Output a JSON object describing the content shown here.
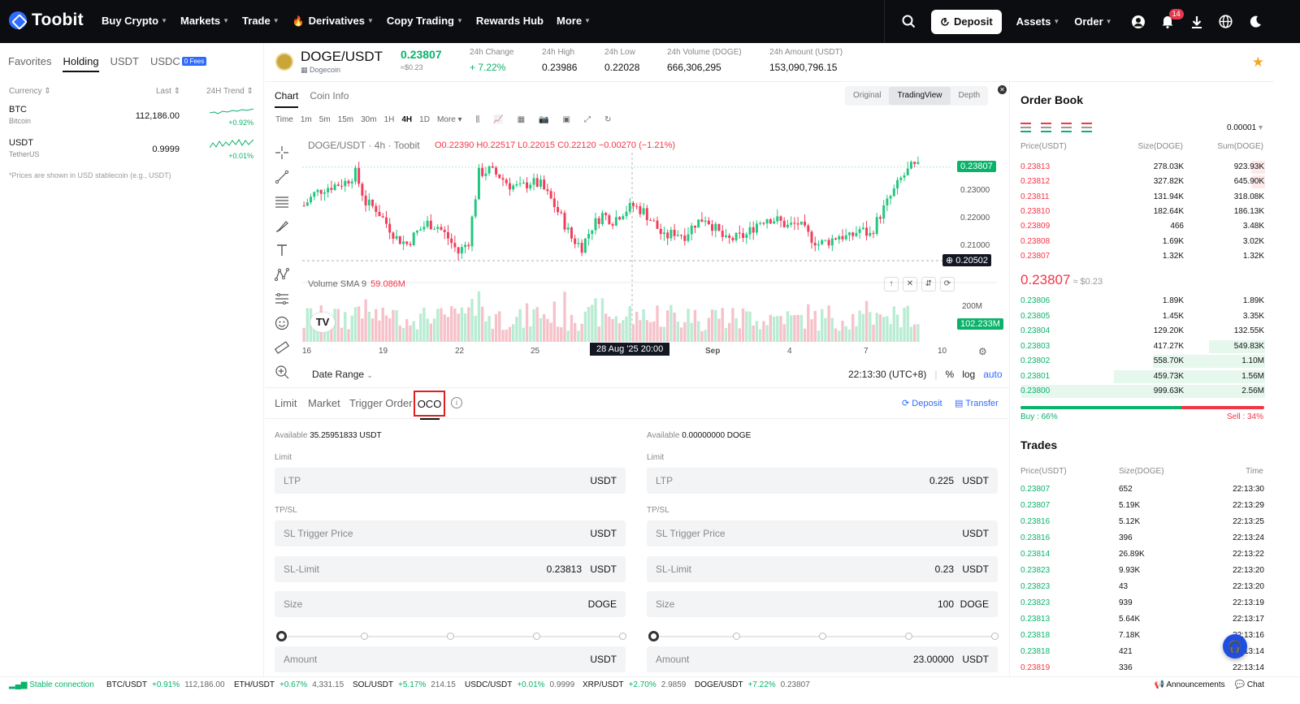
{
  "nav": {
    "brand": "Toobit",
    "items": [
      {
        "label": "Buy Crypto",
        "caret": true
      },
      {
        "label": "Markets",
        "caret": true
      },
      {
        "label": "Trade",
        "caret": true
      },
      {
        "label": "Derivatives",
        "caret": true
      },
      {
        "label": "Copy Trading",
        "caret": true
      },
      {
        "label": "Rewards Hub",
        "caret": false
      },
      {
        "label": "More",
        "caret": true
      }
    ],
    "deposit": "Deposit",
    "assets": "Assets",
    "order": "Order",
    "notif_count": "14"
  },
  "left": {
    "tabs": [
      "Favorites",
      "Holding",
      "USDT",
      "USDC"
    ],
    "fees_badge": "0 Fees",
    "headers": {
      "currency": "Currency",
      "last": "Last",
      "trend": "24H Trend"
    },
    "rows": [
      {
        "symbol": "BTC",
        "name": "Bitcoin",
        "last": "112,186.00",
        "change": "+0.92%"
      },
      {
        "symbol": "USDT",
        "name": "TetherUS",
        "last": "0.9999",
        "change": "+0.01%"
      }
    ],
    "note": "*Prices are shown in USD stablecoin (e.g., USDT)"
  },
  "ticker": {
    "pair": "DOGE/USDT",
    "name": "Dogecoin",
    "last": "0.23807",
    "last_usd": "≈$0.23",
    "stats": [
      {
        "label": "24h Change",
        "value": "+ 7.22%"
      },
      {
        "label": "24h High",
        "value": "0.23986"
      },
      {
        "label": "24h Low",
        "value": "0.22028"
      },
      {
        "label": "24h Volume (DOGE)",
        "value": "666,306,295"
      },
      {
        "label": "24h Amount (USDT)",
        "value": "153,090,796.15"
      }
    ]
  },
  "chart": {
    "tabs": [
      "Chart",
      "Coin Info"
    ],
    "views": [
      "Original",
      "TradingView",
      "Depth"
    ],
    "timeframes": [
      "Time",
      "1m",
      "5m",
      "15m",
      "30m",
      "1H",
      "4H",
      "1D",
      "More"
    ],
    "title": "DOGE/USDT · 4h · Toobit",
    "ohlc": "O0.22390  H0.22517  L0.22015  C0.22120  −0.00270 (−1.21%)",
    "volume_label": "Volume SMA 9",
    "volume_value": "59.086M",
    "price_ticks": [
      "0.23000",
      "0.22000",
      "0.21000"
    ],
    "last_tag": "0.23807",
    "cross_tag": "0.20502",
    "vol_tick": "200M",
    "vol_tag": "102.233M",
    "x_labels": [
      "16",
      "19",
      "22",
      "25",
      "Sep",
      "4",
      "7",
      "10"
    ],
    "cross_time": "28 Aug '25  20:00",
    "date_range": "Date Range",
    "clock": "22:13:30 (UTC+8)",
    "scale_opts": [
      "%",
      "log",
      "auto"
    ]
  },
  "chart_data": {
    "type": "candlestick",
    "x_range": [
      "Aug 14 2025",
      "Sep 10 2025"
    ],
    "y_range": [
      0.203,
      0.243
    ],
    "last_price": 0.23807,
    "approx_closes": [
      0.225,
      0.229,
      0.231,
      0.232,
      0.233,
      0.236,
      0.226,
      0.224,
      0.219,
      0.214,
      0.212,
      0.216,
      0.219,
      0.218,
      0.214,
      0.209,
      0.213,
      0.236,
      0.237,
      0.235,
      0.232,
      0.231,
      0.233,
      0.232,
      0.227,
      0.221,
      0.214,
      0.211,
      0.218,
      0.222,
      0.22,
      0.223,
      0.225,
      0.223,
      0.219,
      0.214,
      0.216,
      0.215,
      0.219,
      0.221,
      0.217,
      0.213,
      0.214,
      0.215,
      0.219,
      0.221,
      0.22,
      0.218,
      0.219,
      0.215,
      0.212,
      0.213,
      0.215,
      0.214,
      0.217,
      0.215,
      0.222,
      0.228,
      0.234,
      0.238
    ]
  },
  "order": {
    "tabs": [
      "Limit",
      "Market",
      "Trigger Order",
      "OCO"
    ],
    "deposit": "Deposit",
    "transfer": "Transfer",
    "buy": {
      "available_label": "Available",
      "available": "35.25951833 USDT",
      "limit_label": "Limit",
      "tpsl_label": "TP/SL",
      "fields": [
        {
          "placeholder": "LTP",
          "value": "",
          "unit": "USDT"
        },
        {
          "placeholder": "SL Trigger Price",
          "value": "",
          "unit": "USDT"
        },
        {
          "placeholder": "SL-Limit",
          "value": "0.23813",
          "unit": "USDT"
        },
        {
          "placeholder": "Size",
          "value": "",
          "unit": "DOGE"
        },
        {
          "placeholder": "Amount",
          "value": "",
          "unit": "USDT"
        }
      ]
    },
    "sell": {
      "available_label": "Available",
      "available": "0.00000000 DOGE",
      "limit_label": "Limit",
      "tpsl_label": "TP/SL",
      "fields": [
        {
          "placeholder": "LTP",
          "value": "0.225",
          "unit": "USDT"
        },
        {
          "placeholder": "SL Trigger Price",
          "value": "",
          "unit": "USDT"
        },
        {
          "placeholder": "SL-Limit",
          "value": "0.23",
          "unit": "USDT"
        },
        {
          "placeholder": "Size",
          "value": "100",
          "unit": "DOGE"
        },
        {
          "placeholder": "Amount",
          "value": "23.00000",
          "unit": "USDT"
        }
      ]
    }
  },
  "orderbook": {
    "title": "Order Book",
    "precision": "0.00001",
    "headers": {
      "price": "Price(USDT)",
      "size": "Size(DOGE)",
      "sum": "Sum(DOGE)"
    },
    "asks": [
      {
        "price": "0.23813",
        "size": "278.03K",
        "sum": "923.93K",
        "depth": 0.24
      },
      {
        "price": "0.23812",
        "size": "327.82K",
        "sum": "645.90K",
        "depth": 0.23
      },
      {
        "price": "0.23811",
        "size": "131.94K",
        "sum": "318.08K",
        "depth": 0.0
      },
      {
        "price": "0.23810",
        "size": "182.64K",
        "sum": "186.13K",
        "depth": 0.0
      },
      {
        "price": "0.23809",
        "size": "466",
        "sum": "3.48K",
        "depth": 0.0
      },
      {
        "price": "0.23808",
        "size": "1.69K",
        "sum": "3.02K",
        "depth": 0.0
      },
      {
        "price": "0.23807",
        "size": "1.32K",
        "sum": "1.32K",
        "depth": 0.0
      }
    ],
    "mid_price": "0.23807",
    "mid_usd": "≈ $0.23",
    "bids": [
      {
        "price": "0.23806",
        "size": "1.89K",
        "sum": "1.89K",
        "depth": 0.0
      },
      {
        "price": "0.23805",
        "size": "1.45K",
        "sum": "3.35K",
        "depth": 0.0
      },
      {
        "price": "0.23804",
        "size": "129.20K",
        "sum": "132.55K",
        "depth": 0.0
      },
      {
        "price": "0.23803",
        "size": "417.27K",
        "sum": "549.83K",
        "depth": 0.23
      },
      {
        "price": "0.23802",
        "size": "558.70K",
        "sum": "1.10M",
        "depth": 0.46
      },
      {
        "price": "0.23801",
        "size": "459.73K",
        "sum": "1.56M",
        "depth": 0.62
      },
      {
        "price": "0.23800",
        "size": "999.63K",
        "sum": "2.56M",
        "depth": 1.0
      }
    ],
    "buy_label": "Buy :  66%",
    "sell_label": "Sell :  34%",
    "buy_ratio": 0.66
  },
  "trades": {
    "title": "Trades",
    "headers": {
      "price": "Price(USDT)",
      "size": "Size(DOGE)",
      "time": "Time"
    },
    "rows": [
      {
        "price": "0.23807",
        "size": "652",
        "time": "22:13:30"
      },
      {
        "price": "0.23807",
        "size": "5.19K",
        "time": "22:13:29"
      },
      {
        "price": "0.23816",
        "size": "5.12K",
        "time": "22:13:25"
      },
      {
        "price": "0.23816",
        "size": "396",
        "time": "22:13:24"
      },
      {
        "price": "0.23814",
        "size": "26.89K",
        "time": "22:13:22"
      },
      {
        "price": "0.23823",
        "size": "9.93K",
        "time": "22:13:20"
      },
      {
        "price": "0.23823",
        "size": "43",
        "time": "22:13:20"
      },
      {
        "price": "0.23823",
        "size": "939",
        "time": "22:13:19"
      },
      {
        "price": "0.23813",
        "size": "5.64K",
        "time": "22:13:17"
      },
      {
        "price": "0.23818",
        "size": "7.18K",
        "time": "22:13:16"
      },
      {
        "price": "0.23818",
        "size": "421",
        "time": "22:13:14"
      },
      {
        "price": "0.23819",
        "size": "336",
        "time": "22:13:14"
      }
    ]
  },
  "footer": {
    "connection": "Stable connection",
    "tickers": [
      {
        "sym": "BTC/USDT",
        "chg": "+0.91%",
        "px": "112,186.00"
      },
      {
        "sym": "ETH/USDT",
        "chg": "+0.67%",
        "px": "4,331.15"
      },
      {
        "sym": "SOL/USDT",
        "chg": "+5.17%",
        "px": "214.15"
      },
      {
        "sym": "USDC/USDT",
        "chg": "+0.01%",
        "px": "0.9999"
      },
      {
        "sym": "XRP/USDT",
        "chg": "+2.70%",
        "px": "2.9859"
      },
      {
        "sym": "DOGE/USDT",
        "chg": "+7.22%",
        "px": "0.23807"
      }
    ],
    "announcements": "Announcements",
    "chat": "Chat"
  },
  "colors": {
    "up": "#0ab26a",
    "down": "#f23645",
    "accent": "#2f6bff",
    "candle_up": "#22c77f",
    "candle_down": "#f23c5a"
  }
}
